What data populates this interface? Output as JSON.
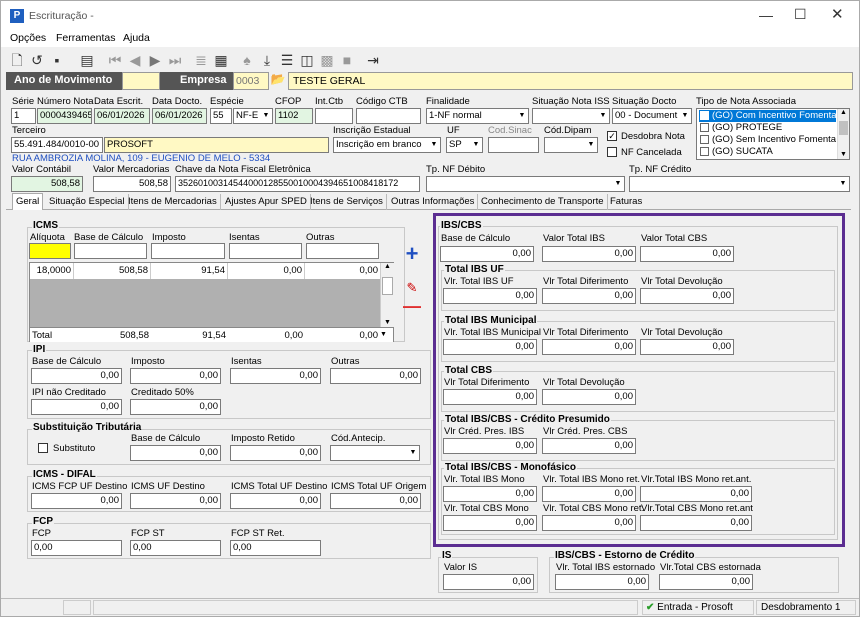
{
  "window": {
    "title": "Escrituração -"
  },
  "menu": [
    "Opções",
    "Ferramentas",
    "Ajuda"
  ],
  "bar": {
    "ano_label": "Ano de Movimento",
    "empresa_label": "Empresa",
    "empresa_code": "0003",
    "empresa_name": "TESTE GERAL"
  },
  "fields": {
    "serie": {
      "label": "Série",
      "value": "1"
    },
    "numero": {
      "label": "Número Nota",
      "value": "0000439465"
    },
    "data_escrit": {
      "label": "Data Escrit.",
      "value": "06/01/2026"
    },
    "data_docto": {
      "label": "Data Docto.",
      "value": "06/01/2026"
    },
    "especie": {
      "label": "Espécie",
      "value": "55",
      "value2": "NF-E"
    },
    "cfop": {
      "label": "CFOP",
      "value": "1102"
    },
    "int_ctb": {
      "label": "Int.Ctb"
    },
    "cod_ctb": {
      "label": "Código CTB"
    },
    "finalidade": {
      "label": "Finalidade",
      "value": "1-NF normal"
    },
    "sit_iss": {
      "label": "Situação Nota ISS"
    },
    "sit_docto": {
      "label": "Situação Docto",
      "value": "00 - Document"
    },
    "tipo_nota": {
      "label": "Tipo de Nota Associada",
      "items": [
        "(GO) Com Incentivo Fomentar,",
        "(GO) PROTEGE",
        "(GO) Sem Incentivo Fomentar/",
        "(GO) SUCATA"
      ]
    },
    "terceiro": {
      "label": "Terceiro",
      "cnpj": "55.491.484/0010-00",
      "name": "PROSOFT",
      "address": "RUA AMBROZIA MOLINA, 109 - EUGENIO DE MELO - 5334"
    },
    "insc_est": {
      "label": "Inscrição Estadual",
      "value": "Inscrição em branco"
    },
    "uf": {
      "label": "UF",
      "value": "SP"
    },
    "cod_sinac": {
      "label": "Cod.Sinac"
    },
    "cod_dipam": {
      "label": "Cód.Dipam"
    },
    "desdobra": {
      "label": "Desdobra Nota",
      "mark": "✓"
    },
    "nf_cancelada": {
      "label": "NF Cancelada"
    },
    "valor_contabil": {
      "label": "Valor Contábil",
      "value": "508,58"
    },
    "valor_merc": {
      "label": "Valor Mercadorias",
      "value": "508,58"
    },
    "chave": {
      "label": "Chave da Nota Fiscal Eletrônica",
      "value": "35260100314544000128550010004394651008418172"
    },
    "tp_debito": {
      "label": "Tp. NF Débito"
    },
    "tp_credito": {
      "label": "Tp. NF Crédito"
    }
  },
  "tabs": [
    "Geral",
    "Situação Especial",
    "Itens de Mercadorias",
    "Ajustes Apur SPED",
    "Itens de Serviços",
    "Outras Informações",
    "Conhecimento de Transporte",
    "Faturas"
  ],
  "icms": {
    "title": "ICMS",
    "headers": [
      "Alíquota",
      "Base de Cálculo",
      "Imposto",
      "Isentas",
      "Outras"
    ],
    "row": [
      "18,0000",
      "508,58",
      "91,54",
      "0,00",
      "0,00"
    ],
    "total": [
      "Total",
      "508,58",
      "91,54",
      "0,00",
      "0,00"
    ]
  },
  "ipi": {
    "title": "IPI",
    "labels": [
      "Base de Cálculo",
      "Imposto",
      "Isentas",
      "Outras"
    ],
    "values": [
      "0,00",
      "0,00",
      "0,00",
      "0,00"
    ],
    "label_nc": "IPI não Creditado",
    "label_c50": "Creditado 50%",
    "nc": "0,00",
    "c50": "0,00"
  },
  "st": {
    "title": "Substituição Tributária",
    "check": "Substituto",
    "labels": [
      "Base de Cálculo",
      "Imposto Retido",
      "Cód.Antecip."
    ],
    "values": [
      "0,00",
      "0,00"
    ]
  },
  "difal": {
    "title": "ICMS - DIFAL",
    "labels": [
      "ICMS FCP UF Destino",
      "ICMS UF Destino",
      "ICMS Total UF Destino",
      "ICMS Total UF Origem"
    ],
    "values": [
      "0,00",
      "0,00",
      "0,00",
      "0,00"
    ]
  },
  "fcp": {
    "title": "FCP",
    "labels": [
      "FCP",
      "FCP ST",
      "FCP ST Ret."
    ],
    "values": [
      "0,00",
      "0,00",
      "0,00"
    ]
  },
  "ibscbs": {
    "title": "IBS/CBS",
    "labels": [
      "Base de Cálculo",
      "Valor Total IBS",
      "Valor Total CBS"
    ],
    "values": [
      "0,00",
      "0,00",
      "0,00"
    ],
    "uf": {
      "title": "Total IBS UF",
      "labels": [
        "Vlr. Total IBS UF",
        "Vlr Total Diferimento",
        "Vlr Total Devolução"
      ],
      "values": [
        "0,00",
        "0,00",
        "0,00"
      ]
    },
    "mun": {
      "title": "Total IBS Municipal",
      "labels": [
        "Vlr. Total IBS Municipal",
        "Vlr Total Diferimento",
        "Vlr Total Devolução"
      ],
      "values": [
        "0,00",
        "0,00",
        "0,00"
      ]
    },
    "cbs": {
      "title": "Total CBS",
      "labels": [
        "Vlr Total Diferimento",
        "Vlr Total Devolução"
      ],
      "values": [
        "0,00",
        "0,00"
      ]
    },
    "pres": {
      "title": "Total IBS/CBS - Crédito Presumido",
      "labels": [
        "Vlr Créd. Pres. IBS",
        "Vlr Créd. Pres. CBS"
      ],
      "values": [
        "0,00",
        "0,00"
      ]
    },
    "mono": {
      "title": "Total IBS/CBS - Monofásico",
      "labels": [
        "Vlr. Total IBS Mono",
        "Vlr. Total IBS Mono ret.",
        "Vlr.Total IBS Mono ret.ant.",
        "Vlr. Total CBS Mono",
        "Vlr. Total CBS Mono ret.",
        "Vlr.Total CBS Mono ret.ant"
      ],
      "values": [
        "0,00",
        "0,00",
        "0,00",
        "0,00",
        "0,00",
        "0,00"
      ]
    }
  },
  "is": {
    "title": "IS",
    "label": "Valor IS",
    "value": "0,00"
  },
  "estorno": {
    "title": "IBS/CBS - Estorno de Crédito",
    "labels": [
      "Vlr. Total IBS estornado",
      "Vlr.Total CBS estornada"
    ],
    "values": [
      "0,00",
      "0,00"
    ]
  },
  "status": {
    "mode": "Entrada - Prosoft",
    "desdob": "Desdobramento 1"
  },
  "colors": {
    "accent": "#5b2d91",
    "highlight": "#ffff00",
    "title_bar": "#555555",
    "link_blue": "#1f4fc1"
  }
}
